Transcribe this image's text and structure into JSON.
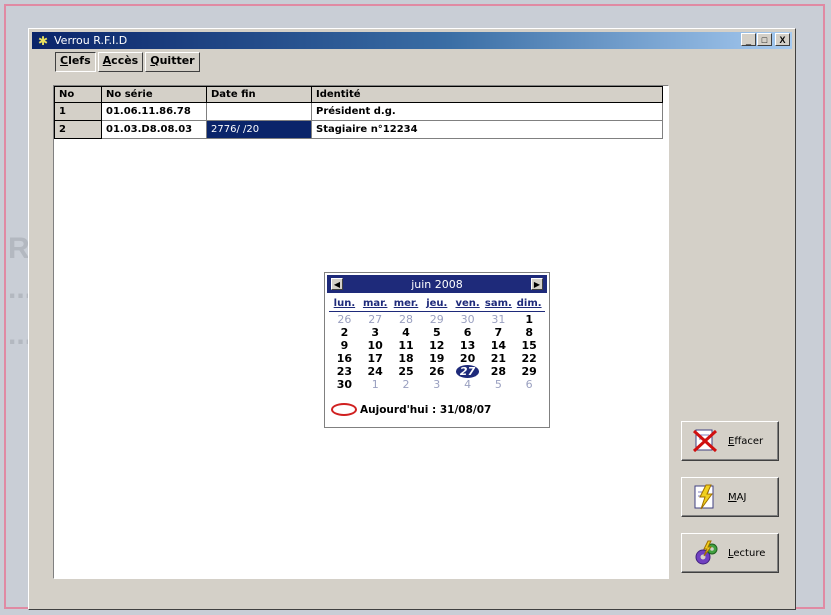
{
  "window": {
    "title": "Verrou R.F.I.D",
    "controls": {
      "minimize": "_",
      "maximize": "□",
      "close": "X"
    }
  },
  "menu": [
    {
      "label": "Clefs"
    },
    {
      "label": "Accès"
    },
    {
      "label": "Quitter"
    }
  ],
  "table": {
    "columns": [
      "No",
      "No série",
      "Date fin",
      "Identité"
    ],
    "rows": [
      {
        "no": "1",
        "serie": "01.06.11.86.78",
        "date_fin": "",
        "identite": "Président d.g."
      },
      {
        "no": "2",
        "serie": "01.03.D8.08.03",
        "date_fin": "2776/ /20",
        "identite": "Stagiaire n°12234"
      }
    ]
  },
  "calendar": {
    "month_label": "juin 2008",
    "days_of_week": [
      "lun.",
      "mar.",
      "mer.",
      "jeu.",
      "ven.",
      "sam.",
      "dim."
    ],
    "weeks": [
      [
        "26",
        "27",
        "28",
        "29",
        "30",
        "31",
        "1"
      ],
      [
        "2",
        "3",
        "4",
        "5",
        "6",
        "7",
        "8"
      ],
      [
        "9",
        "10",
        "11",
        "12",
        "13",
        "14",
        "15"
      ],
      [
        "16",
        "17",
        "18",
        "19",
        "20",
        "21",
        "22"
      ],
      [
        "23",
        "24",
        "25",
        "26",
        "27",
        "28",
        "29"
      ],
      [
        "30",
        "1",
        "2",
        "3",
        "4",
        "5",
        "6"
      ]
    ],
    "selected_day": "27",
    "today_label": "Aujourd'hui : 31/08/07"
  },
  "actions": [
    {
      "label": "Effacer",
      "icon": "erase-icon"
    },
    {
      "label": "MAJ",
      "icon": "update-icon"
    },
    {
      "label": "Lecture",
      "icon": "read-icon"
    }
  ]
}
